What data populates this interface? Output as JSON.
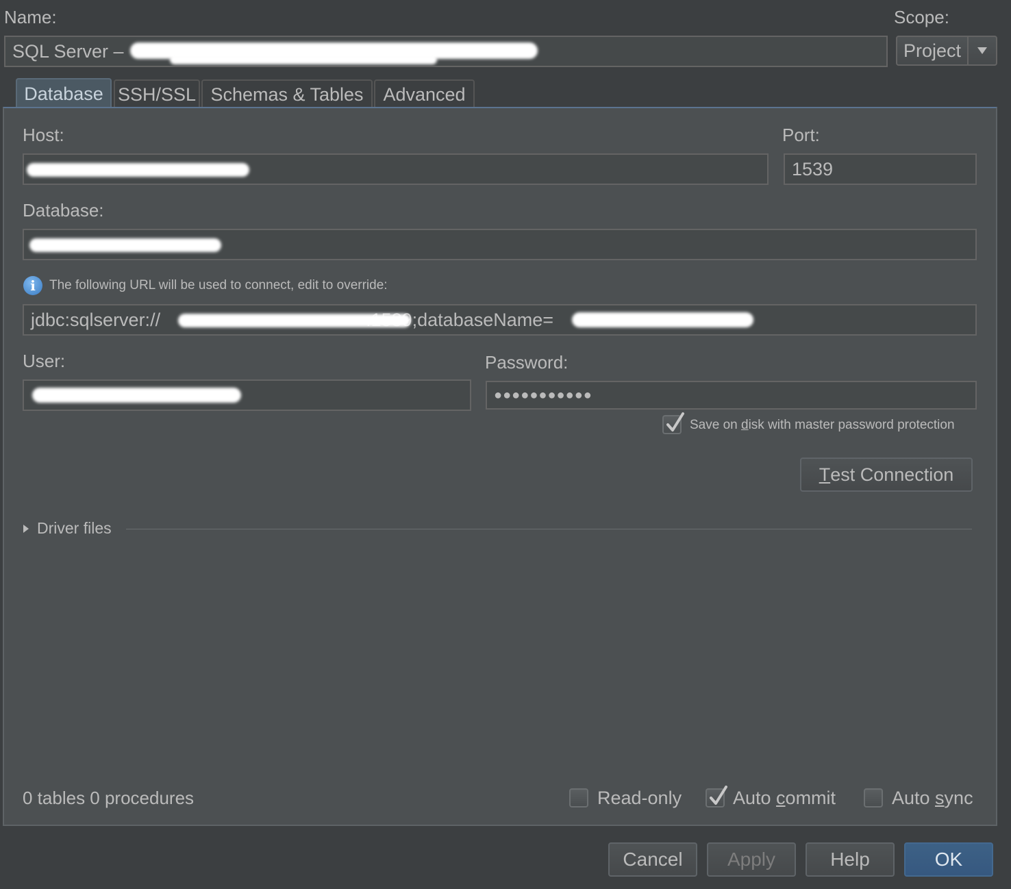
{
  "header": {
    "name_label": "Name:",
    "name_value": "SQL Server –",
    "scope_label": "Scope:",
    "scope_value": "Project"
  },
  "tabs": [
    {
      "label": "Database",
      "active": true
    },
    {
      "label": "SSH/SSL",
      "active": false
    },
    {
      "label": "Schemas & Tables",
      "active": false
    },
    {
      "label": "Advanced",
      "active": false
    }
  ],
  "form": {
    "host_label": "Host:",
    "host_value": "",
    "port_label": "Port:",
    "port_value": "1539",
    "database_label": "Database:",
    "database_value": "",
    "url_info": "The following URL will be used to connect, edit to override:",
    "url_prefix": "jdbc:sqlserver://",
    "url_middle": ".1539;databaseName=",
    "user_label": "User:",
    "user_value": "",
    "password_label": "Password:",
    "password_value": "●●●●●●●●●●●",
    "save_on_disk_pre": "Save on ",
    "save_on_disk_ul": "d",
    "save_on_disk_post": "isk with master password protection",
    "save_on_disk_checked": true,
    "test_connection_ul": "T",
    "test_connection_rest": "est Connection",
    "driver_files_label": "Driver files"
  },
  "status": {
    "summary": "0 tables 0 procedures",
    "readonly_label": "Read-only",
    "readonly_checked": false,
    "autocommit_pre": "Auto ",
    "autocommit_ul": "c",
    "autocommit_post": "ommit",
    "autocommit_checked": true,
    "autosync_pre": "Auto ",
    "autosync_ul": "s",
    "autosync_post": "ync",
    "autosync_checked": false
  },
  "footer": {
    "cancel": "Cancel",
    "apply": "Apply",
    "help": "Help",
    "ok": "OK"
  },
  "colors": {
    "background": "#3c3f41",
    "panel": "#4c5052",
    "active_tab": "#4b5963",
    "primary_button": "#365880",
    "info_icon": "#4a90d9"
  }
}
